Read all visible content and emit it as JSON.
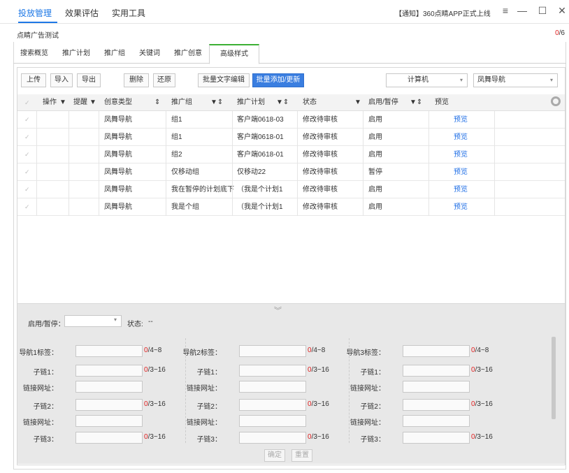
{
  "topnav": [
    "投放管理",
    "效果评估",
    "实用工具"
  ],
  "notice": "【通知】360点睛APP正式上线",
  "window": {
    "menu": "≡",
    "min": "—",
    "max": "☐",
    "close": "✕"
  },
  "subtitle": "点睛广告测试",
  "counter": {
    "num": "0",
    "total": "/6"
  },
  "tabs": [
    "搜索概览",
    "推广计划",
    "推广组",
    "关键词",
    "推广创意",
    "高级样式"
  ],
  "toolbar": {
    "upload": "上传",
    "import": "导入",
    "export": "导出",
    "delete": "删除",
    "restore": "还原",
    "batch_edit": "批量文字编辑",
    "batch_add": "批量添加/更新",
    "device": "计算机",
    "style": "凤舞导航"
  },
  "columns": [
    "操作",
    "提醒",
    "创意类型",
    "推广组",
    "推广计划",
    "状态",
    "启用/暂停",
    "预览"
  ],
  "rows": [
    {
      "type": "凤舞导航",
      "group": "组1",
      "plan": "客户端0618-03",
      "status": "修改待审核",
      "enable": "启用",
      "preview": "预览"
    },
    {
      "type": "凤舞导航",
      "group": "组1",
      "plan": "客户端0618-01",
      "status": "修改待审核",
      "enable": "启用",
      "preview": "预览"
    },
    {
      "type": "凤舞导航",
      "group": "组2",
      "plan": "客户端0618-01",
      "status": "修改待审核",
      "enable": "启用",
      "preview": "预览"
    },
    {
      "type": "凤舞导航",
      "group": "仅移动组",
      "plan": "仅移动22",
      "status": "修改待审核",
      "enable": "暂停",
      "preview": "预览"
    },
    {
      "type": "凤舞导航",
      "group": "我在暂停的计划底下",
      "plan": "（我是个计划1",
      "status": "修改待审核",
      "enable": "启用",
      "preview": "预览"
    },
    {
      "type": "凤舞导航",
      "group": "我是个组",
      "plan": "（我是个计划1",
      "status": "修改待审核",
      "enable": "启用",
      "preview": "预览"
    }
  ],
  "form": {
    "enable_label": "启用/暂停：",
    "status_label": "状态:",
    "status_value": "--",
    "nav_labels": [
      "导航1标签：",
      "导航2标签：",
      "导航3标签："
    ],
    "nav_count": "/4~8",
    "sub_labels": [
      "子链1：",
      "子链2：",
      "子链3："
    ],
    "sub_count": "/3~16",
    "url_label": "链接网址：",
    "zero": "0",
    "confirm": "确定",
    "reset": "重置"
  }
}
